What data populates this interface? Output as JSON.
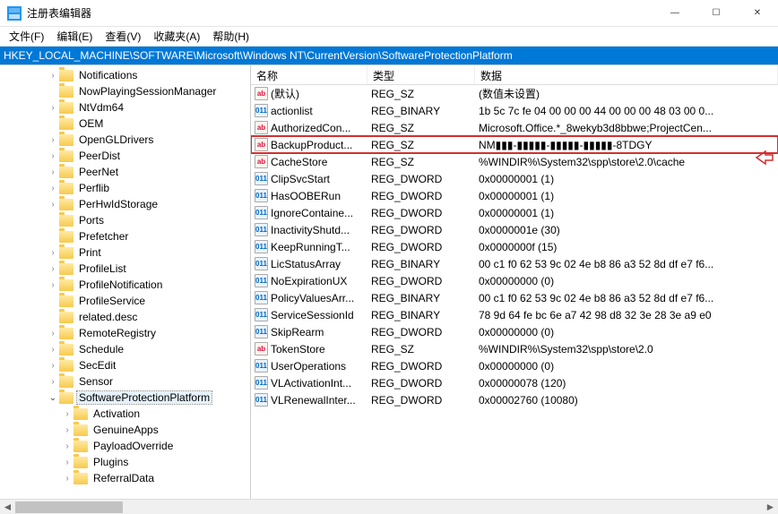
{
  "window": {
    "title": "注册表编辑器"
  },
  "menu": {
    "file": "文件(F)",
    "edit": "编辑(E)",
    "view": "查看(V)",
    "favorites": "收藏夹(A)",
    "help": "帮助(H)"
  },
  "address": "HKEY_LOCAL_MACHINE\\SOFTWARE\\Microsoft\\Windows NT\\CurrentVersion\\SoftwareProtectionPlatform",
  "tree": [
    {
      "label": "Notifications",
      "depth": 3,
      "expander": ">"
    },
    {
      "label": "NowPlayingSessionManager",
      "depth": 3,
      "expander": ""
    },
    {
      "label": "NtVdm64",
      "depth": 3,
      "expander": ">"
    },
    {
      "label": "OEM",
      "depth": 3,
      "expander": ""
    },
    {
      "label": "OpenGLDrivers",
      "depth": 3,
      "expander": ">"
    },
    {
      "label": "PeerDist",
      "depth": 3,
      "expander": ">"
    },
    {
      "label": "PeerNet",
      "depth": 3,
      "expander": ">"
    },
    {
      "label": "Perflib",
      "depth": 3,
      "expander": ">"
    },
    {
      "label": "PerHwIdStorage",
      "depth": 3,
      "expander": ">"
    },
    {
      "label": "Ports",
      "depth": 3,
      "expander": ""
    },
    {
      "label": "Prefetcher",
      "depth": 3,
      "expander": ""
    },
    {
      "label": "Print",
      "depth": 3,
      "expander": ">"
    },
    {
      "label": "ProfileList",
      "depth": 3,
      "expander": ">"
    },
    {
      "label": "ProfileNotification",
      "depth": 3,
      "expander": ">"
    },
    {
      "label": "ProfileService",
      "depth": 3,
      "expander": ""
    },
    {
      "label": "related.desc",
      "depth": 3,
      "expander": ""
    },
    {
      "label": "RemoteRegistry",
      "depth": 3,
      "expander": ">"
    },
    {
      "label": "Schedule",
      "depth": 3,
      "expander": ">"
    },
    {
      "label": "SecEdit",
      "depth": 3,
      "expander": ">"
    },
    {
      "label": "Sensor",
      "depth": 3,
      "expander": ">"
    },
    {
      "label": "SoftwareProtectionPlatform",
      "depth": 3,
      "expander": "v",
      "selected": true
    },
    {
      "label": "Activation",
      "depth": 4,
      "expander": ">"
    },
    {
      "label": "GenuineApps",
      "depth": 4,
      "expander": ">"
    },
    {
      "label": "PayloadOverride",
      "depth": 4,
      "expander": ">"
    },
    {
      "label": "Plugins",
      "depth": 4,
      "expander": ">"
    },
    {
      "label": "ReferralData",
      "depth": 4,
      "expander": ">"
    }
  ],
  "listHeaders": {
    "name": "名称",
    "type": "类型",
    "data": "数据"
  },
  "values": [
    {
      "icon": "sz",
      "name": "(默认)",
      "type": "REG_SZ",
      "data": "(数值未设置)",
      "highlight": false
    },
    {
      "icon": "bin",
      "name": "actionlist",
      "type": "REG_BINARY",
      "data": "1b 5c 7c fe 04 00 00 00 44 00 00 00 48 03 00 0...",
      "highlight": false
    },
    {
      "icon": "sz",
      "name": "AuthorizedCon...",
      "type": "REG_SZ",
      "data": "Microsoft.Office.*_8wekyb3d8bbwe;ProjectCen...",
      "highlight": false
    },
    {
      "icon": "sz",
      "name": "BackupProduct...",
      "type": "REG_SZ",
      "data": "NM▮▮▮-▮▮▮▮▮-▮▮▮▮▮-▮▮▮▮▮-8TDGY",
      "highlight": true
    },
    {
      "icon": "sz",
      "name": "CacheStore",
      "type": "REG_SZ",
      "data": "%WINDIR%\\System32\\spp\\store\\2.0\\cache",
      "highlight": false
    },
    {
      "icon": "bin",
      "name": "ClipSvcStart",
      "type": "REG_DWORD",
      "data": "0x00000001 (1)",
      "highlight": false
    },
    {
      "icon": "bin",
      "name": "HasOOBERun",
      "type": "REG_DWORD",
      "data": "0x00000001 (1)",
      "highlight": false
    },
    {
      "icon": "bin",
      "name": "IgnoreContaine...",
      "type": "REG_DWORD",
      "data": "0x00000001 (1)",
      "highlight": false
    },
    {
      "icon": "bin",
      "name": "InactivityShutd...",
      "type": "REG_DWORD",
      "data": "0x0000001e (30)",
      "highlight": false
    },
    {
      "icon": "bin",
      "name": "KeepRunningT...",
      "type": "REG_DWORD",
      "data": "0x0000000f (15)",
      "highlight": false
    },
    {
      "icon": "bin",
      "name": "LicStatusArray",
      "type": "REG_BINARY",
      "data": "00 c1 f0 62 53 9c 02 4e b8 86 a3 52 8d df e7 f6...",
      "highlight": false
    },
    {
      "icon": "bin",
      "name": "NoExpirationUX",
      "type": "REG_DWORD",
      "data": "0x00000000 (0)",
      "highlight": false
    },
    {
      "icon": "bin",
      "name": "PolicyValuesArr...",
      "type": "REG_BINARY",
      "data": "00 c1 f0 62 53 9c 02 4e b8 86 a3 52 8d df e7 f6...",
      "highlight": false
    },
    {
      "icon": "bin",
      "name": "ServiceSessionId",
      "type": "REG_BINARY",
      "data": "78 9d 64 fe bc 6e a7 42 98 d8 32 3e 28 3e a9 e0",
      "highlight": false
    },
    {
      "icon": "bin",
      "name": "SkipRearm",
      "type": "REG_DWORD",
      "data": "0x00000000 (0)",
      "highlight": false
    },
    {
      "icon": "sz",
      "name": "TokenStore",
      "type": "REG_SZ",
      "data": "%WINDIR%\\System32\\spp\\store\\2.0",
      "highlight": false
    },
    {
      "icon": "bin",
      "name": "UserOperations",
      "type": "REG_DWORD",
      "data": "0x00000000 (0)",
      "highlight": false
    },
    {
      "icon": "bin",
      "name": "VLActivationInt...",
      "type": "REG_DWORD",
      "data": "0x00000078 (120)",
      "highlight": false
    },
    {
      "icon": "bin",
      "name": "VLRenewalInter...",
      "type": "REG_DWORD",
      "data": "0x00002760 (10080)",
      "highlight": false
    }
  ],
  "iconGlyphs": {
    "sz": "ab",
    "bin": "011"
  }
}
